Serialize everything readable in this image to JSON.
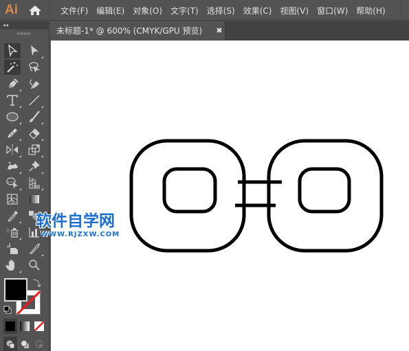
{
  "app": {
    "logo": "Ai",
    "accent_color": "#d88a4d"
  },
  "menubar": {
    "items": [
      {
        "label": "文件(F)"
      },
      {
        "label": "编辑(E)"
      },
      {
        "label": "对象(O)"
      },
      {
        "label": "文字(T)"
      },
      {
        "label": "选择(S)"
      },
      {
        "label": "效果(C)"
      },
      {
        "label": "视图(V)"
      },
      {
        "label": "窗口(W)"
      },
      {
        "label": "帮助(H)"
      }
    ]
  },
  "document_tab": {
    "title": "未标题-1* @ 600% (CMYK/GPU 预览)",
    "close_glyph": "✖"
  },
  "toolbar": {
    "collapse_glyph": "◂◂",
    "tools": [
      {
        "name": "selection-tool",
        "active": true
      },
      {
        "name": "direct-selection-tool",
        "active": false
      },
      {
        "name": "magic-wand-tool",
        "active": true
      },
      {
        "name": "lasso-tool",
        "active": false
      },
      {
        "name": "pen-tool",
        "active": false
      },
      {
        "name": "curvature-tool",
        "active": false
      },
      {
        "name": "type-tool",
        "active": false
      },
      {
        "name": "line-segment-tool",
        "active": false
      },
      {
        "name": "ellipse-tool",
        "active": false
      },
      {
        "name": "paintbrush-tool",
        "active": false
      },
      {
        "name": "shaper-tool",
        "active": false
      },
      {
        "name": "eraser-tool",
        "active": false
      },
      {
        "name": "reflect-tool",
        "active": false
      },
      {
        "name": "scale-tool",
        "active": false
      },
      {
        "name": "puppet-warp-tool",
        "active": false
      },
      {
        "name": "pin-tool",
        "active": false
      },
      {
        "name": "shape-builder-tool",
        "active": false
      },
      {
        "name": "perspective-grid-tool",
        "active": false
      },
      {
        "name": "mesh-tool",
        "active": false
      },
      {
        "name": "gradient-tool",
        "active": false
      },
      {
        "name": "eyedropper-tool",
        "active": false
      },
      {
        "name": "blend-tool",
        "active": false
      },
      {
        "name": "symbol-sprayer-tool",
        "active": false
      },
      {
        "name": "column-graph-tool",
        "active": false
      },
      {
        "name": "artboard-tool",
        "active": false
      },
      {
        "name": "slice-tool",
        "active": false
      },
      {
        "name": "hand-tool",
        "active": false
      },
      {
        "name": "zoom-tool",
        "active": false
      }
    ],
    "fill_color": "#000000",
    "stroke_color": "none",
    "swap_glyph": "⤵"
  },
  "canvas": {
    "background": "#ffffff",
    "stroke_color": "#000000"
  },
  "watermark": {
    "title": "软件自学网",
    "url": "WWW.RJZXW.COM",
    "color": "#1a6fd0"
  }
}
